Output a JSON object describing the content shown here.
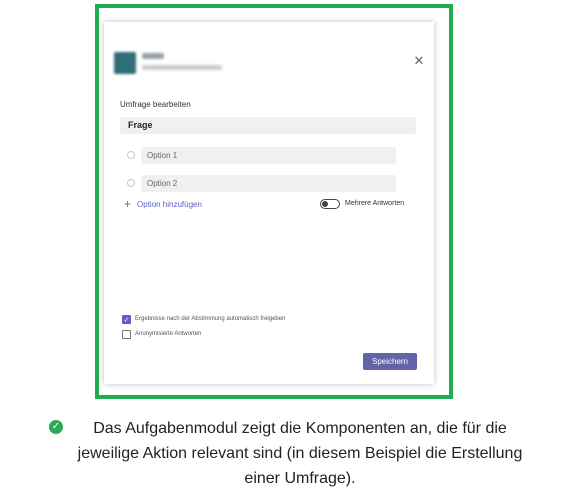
{
  "dialog": {
    "close_glyph": "✕",
    "heading": "Umfrage bearbeiten",
    "question_label": "Frage",
    "options": [
      {
        "label": "Option 1"
      },
      {
        "label": "Option 2"
      }
    ],
    "add_option_label": "Option hinzufügen",
    "multi_answer_label": "Mehrere Antworten",
    "multi_answer_enabled": false,
    "checkboxes": [
      {
        "label": "Ergebnisse nach der Abstimmung automatisch freigeben",
        "checked": true
      },
      {
        "label": "Anonymisierte Antworten",
        "checked": false
      }
    ],
    "save_label": "Speichern",
    "accent_color": "#6264a7"
  },
  "frame_color": "#1fae4f",
  "caption": {
    "icon": "check-circle-icon",
    "text": "Das Aufgabenmodul zeigt die Komponenten an, die für die jeweilige Aktion relevant sind (in diesem Beispiel die Erstellung einer Umfrage)."
  }
}
